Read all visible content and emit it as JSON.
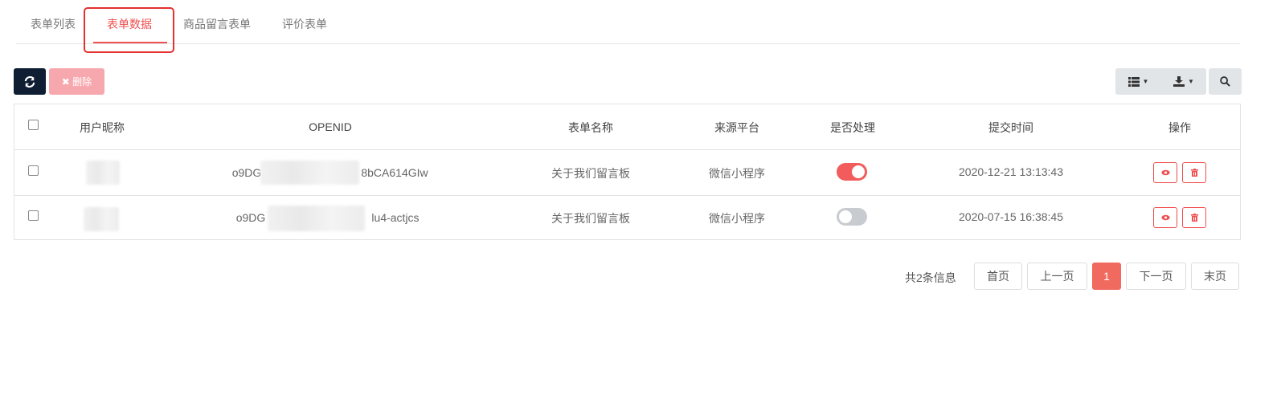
{
  "tabs": [
    {
      "label": "表单列表"
    },
    {
      "label": "表单数据"
    },
    {
      "label": "商品留言表单"
    },
    {
      "label": "评价表单"
    }
  ],
  "toolbar": {
    "refresh_icon": "refresh-icon",
    "delete_label": "✖ 删除"
  },
  "table": {
    "columns": [
      "用户昵称",
      "OPENID",
      "表单名称",
      "来源平台",
      "是否处理",
      "提交时间",
      "操作"
    ],
    "rows": [
      {
        "openid_prefix": "o9DG",
        "openid_suffix": "8bCA614GIw",
        "form_name": "关于我们留言板",
        "platform": "微信小程序",
        "processed": true,
        "submit_time": "2020-12-21 13:13:43"
      },
      {
        "openid_prefix": "o9DG",
        "openid_suffix": "lu4-actjcs",
        "form_name": "关于我们留言板",
        "platform": "微信小程序",
        "processed": false,
        "submit_time": "2020-07-15 16:38:45"
      }
    ]
  },
  "pagination": {
    "info": "共2条信息",
    "first": "首页",
    "prev": "上一页",
    "current": "1",
    "next": "下一页",
    "last": "末页"
  },
  "colors": {
    "accent": "#f05050",
    "toggle_on": "#f25c5c",
    "toggle_off": "#c8cbd0",
    "refresh_bg": "#0f1e33"
  }
}
